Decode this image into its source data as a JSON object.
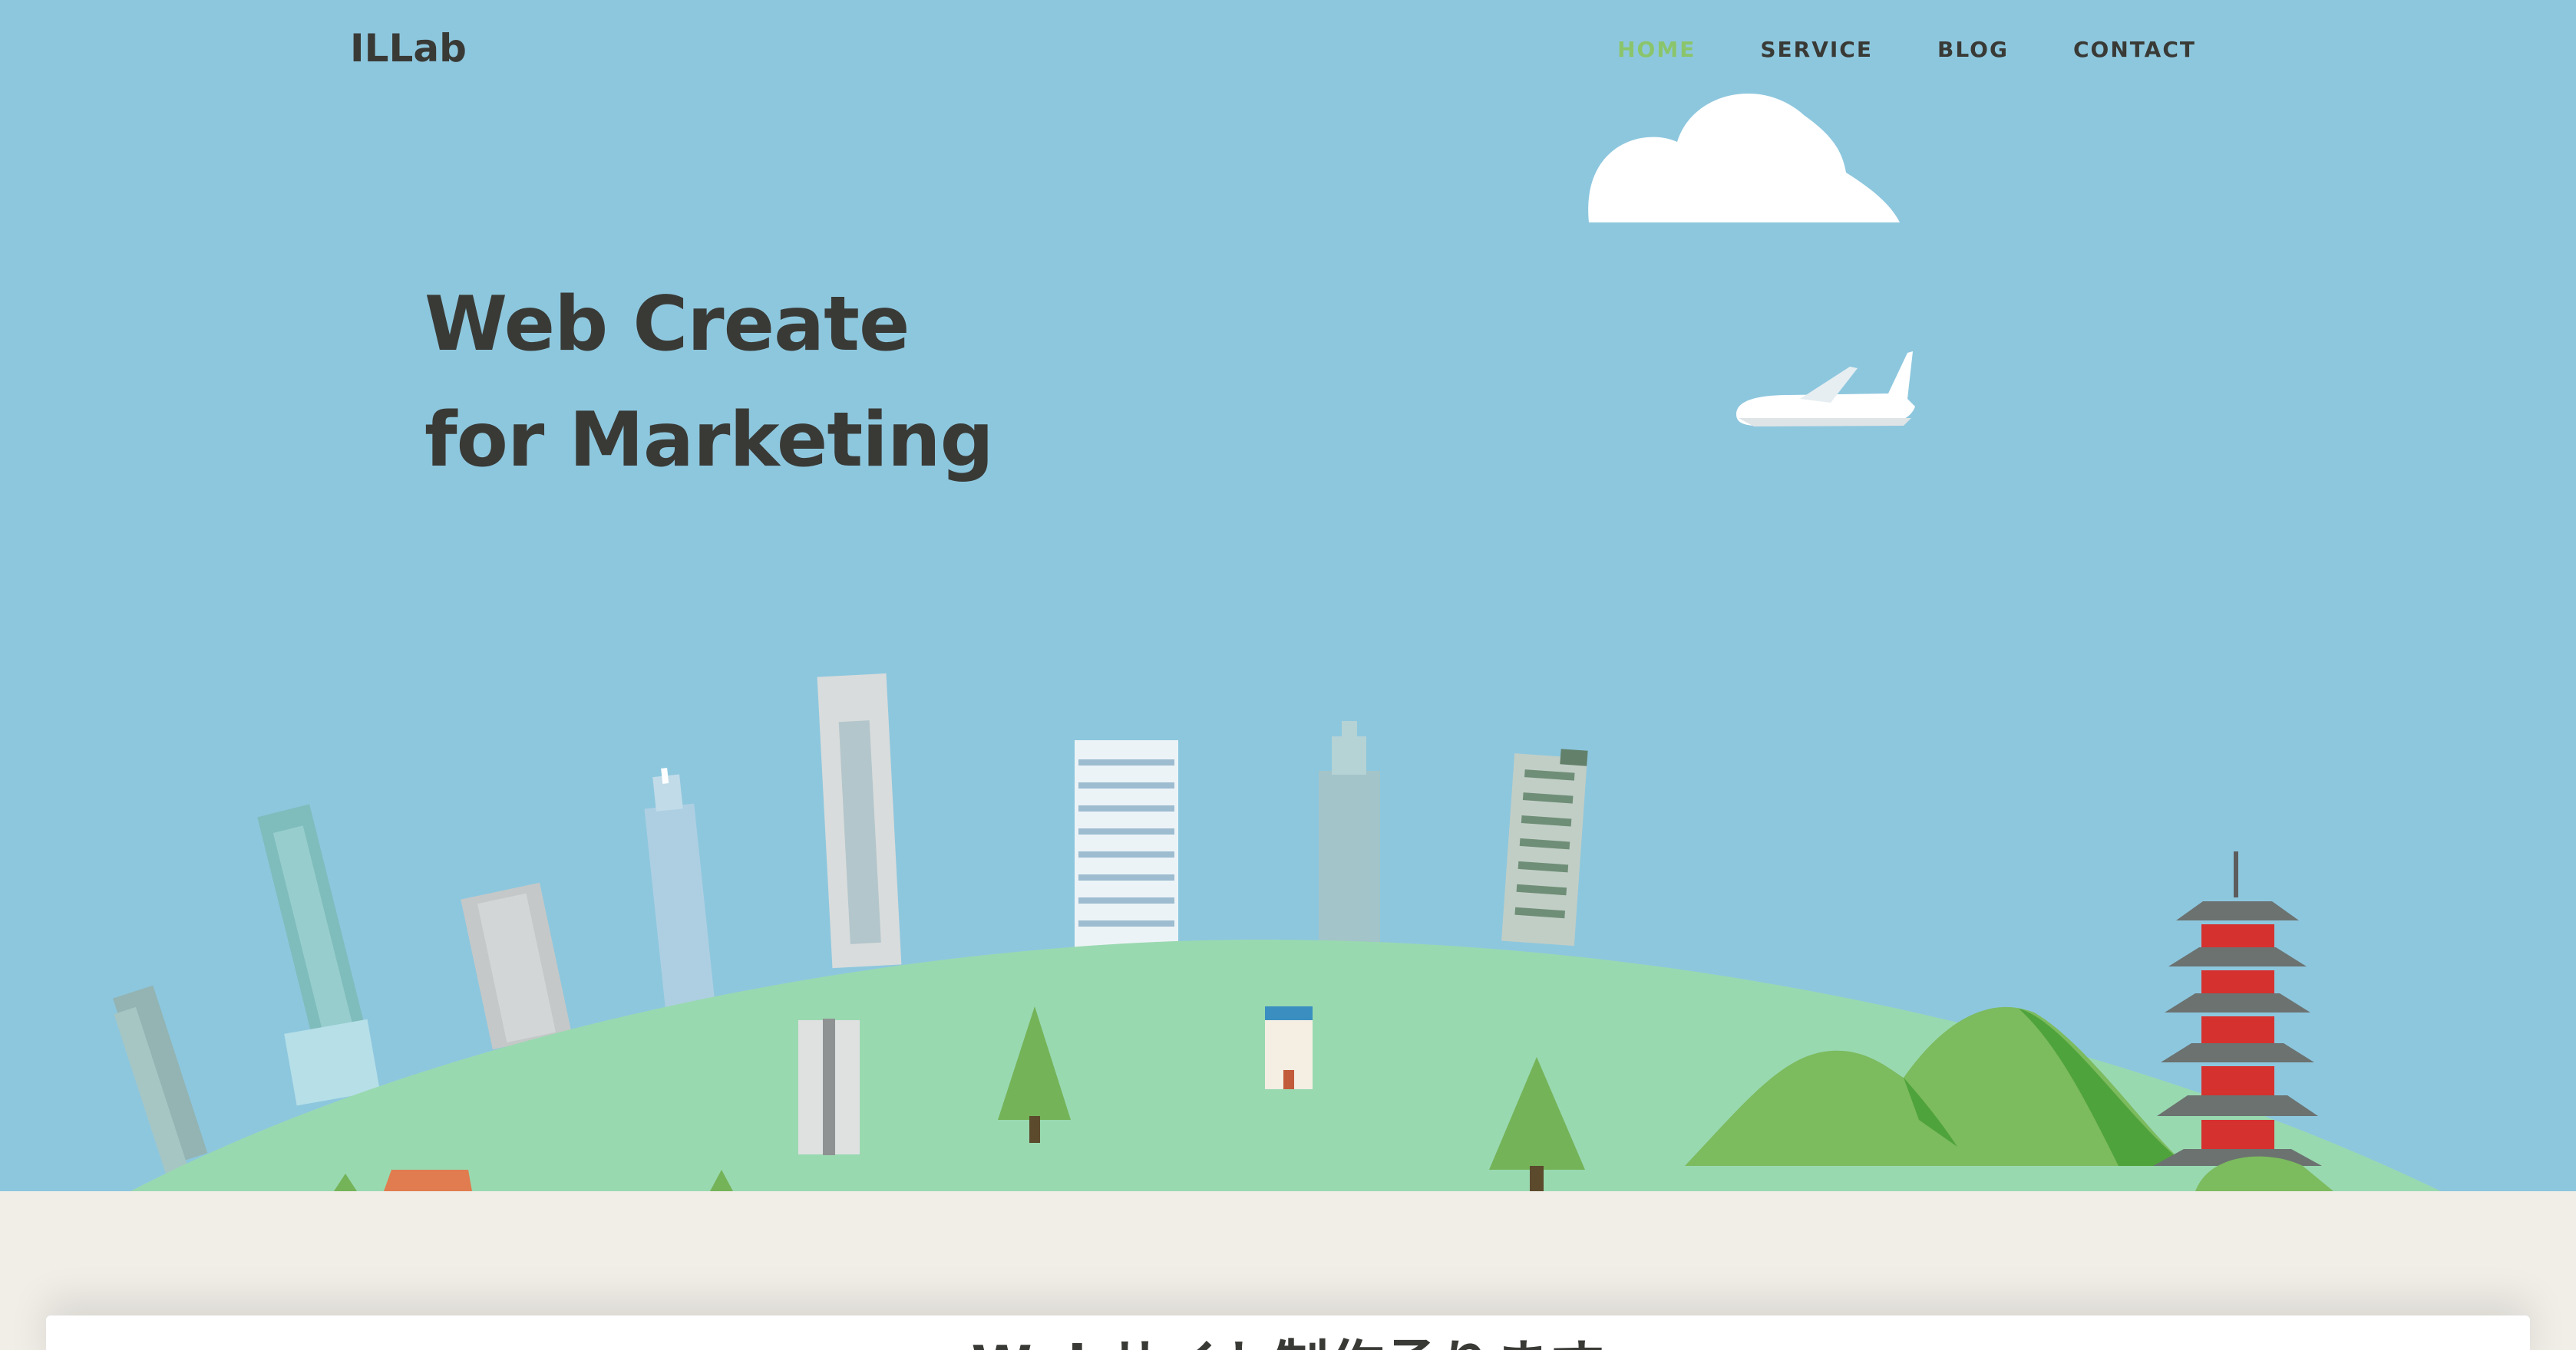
{
  "header": {
    "logo": "ILLab",
    "nav": [
      {
        "label": "HOME",
        "active": true
      },
      {
        "label": "SERVICE",
        "active": false
      },
      {
        "label": "BLOG",
        "active": false
      },
      {
        "label": "CONTACT",
        "active": false
      }
    ]
  },
  "hero": {
    "headline_line1": "Web Create",
    "headline_line2": "for Marketing",
    "illustration_items": [
      "cloud-icon",
      "airplane-icon",
      "skyscraper-icon",
      "tree-icon",
      "mountain-icon",
      "pagoda-icon",
      "hotel-icon"
    ]
  },
  "section": {
    "title": "Webサイト制作承ります"
  },
  "colors": {
    "sky": "#8dc7de",
    "hill": "#99d9b0",
    "mountain": "#7cbb5e",
    "text": "#393a36",
    "accent": "#8bc56b",
    "background": "#f1eee8"
  }
}
